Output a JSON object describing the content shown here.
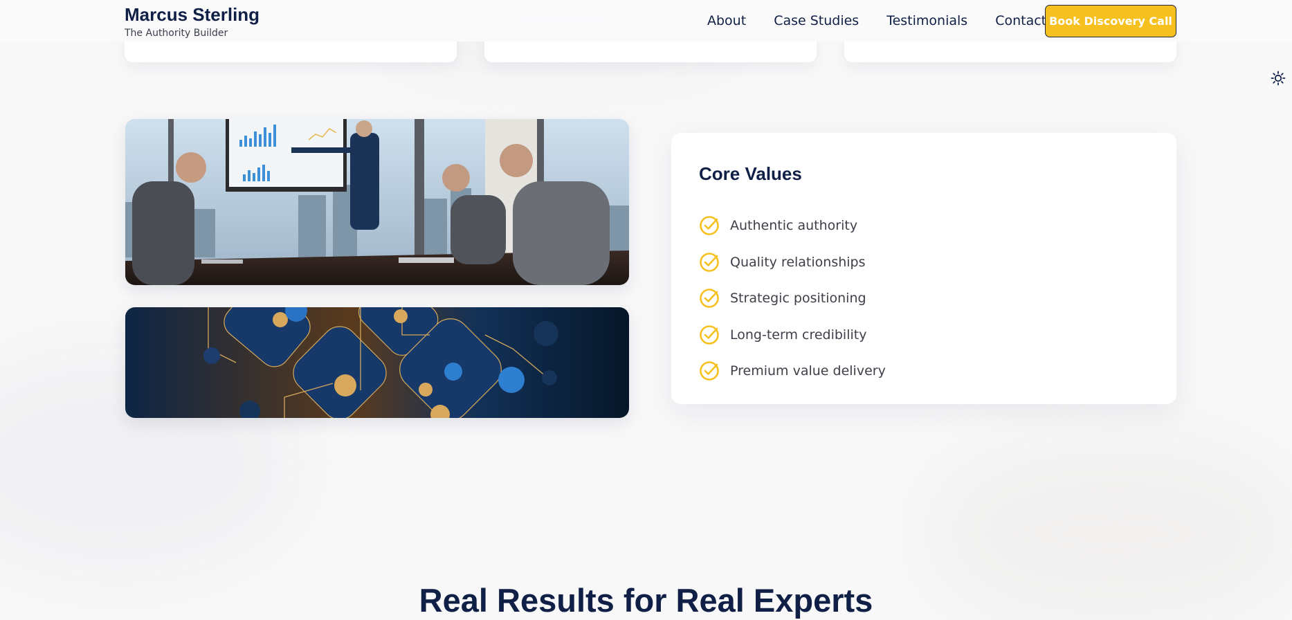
{
  "brand": {
    "name": "Marcus Sterling",
    "tagline": "The Authority Builder"
  },
  "nav": {
    "links": [
      "About",
      "Case Studies",
      "Testimonials",
      "Contact"
    ],
    "cta_label": "Book Discovery Call"
  },
  "theme_toggle": {
    "icon": "sun-icon"
  },
  "images": [
    {
      "name": "team-meeting-photo",
      "description_icon": "photo"
    },
    {
      "name": "network-abstract-illustration",
      "description_icon": "photo"
    }
  ],
  "core_values": {
    "title": "Core Values",
    "items": [
      "Authentic authority",
      "Quality relationships",
      "Strategic positioning",
      "Long-term credibility",
      "Premium value delivery"
    ]
  },
  "results": {
    "heading": "Real Results for Real Experts"
  },
  "colors": {
    "navy": "#0f1f45",
    "accent_gold": "#f6c11f",
    "background": "#f8f8f9",
    "card": "#ffffff"
  }
}
